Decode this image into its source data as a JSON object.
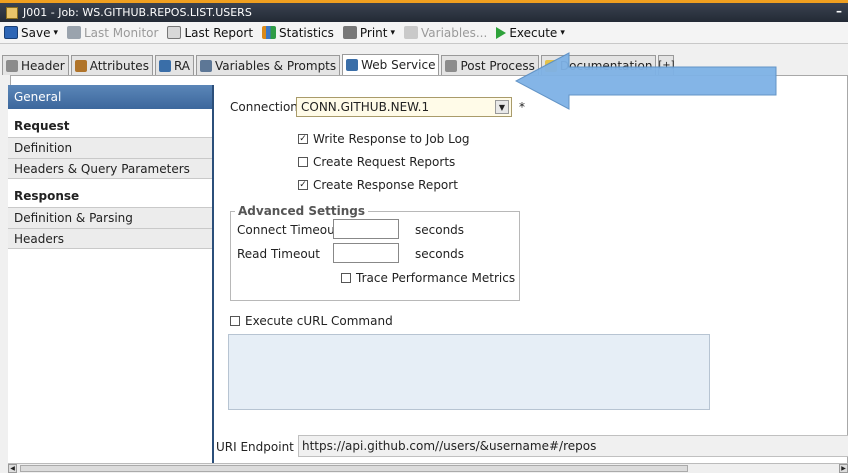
{
  "window": {
    "title": "J001 - Job: WS.GITHUB.REPOS.LIST.USERS",
    "minimize": "–"
  },
  "toolbar": {
    "save": "Save",
    "last_monitor": "Last Monitor",
    "last_report": "Last Report",
    "statistics": "Statistics",
    "print": "Print",
    "variables": "Variables...",
    "execute": "Execute"
  },
  "tabs": [
    {
      "label": "Header"
    },
    {
      "label": "Attributes"
    },
    {
      "label": "RA"
    },
    {
      "label": "Variables & Prompts"
    },
    {
      "label": "Web Service",
      "active": true
    },
    {
      "label": "Post Process"
    },
    {
      "label": "Documentation"
    }
  ],
  "sidebar": {
    "general": "General",
    "request_head": "Request",
    "request_items": [
      "Definition",
      "Headers & Query Parameters"
    ],
    "response_head": "Response",
    "response_items": [
      "Definition & Parsing",
      "Headers"
    ]
  },
  "main": {
    "connection_label": "Connection",
    "connection_value": "CONN.GITHUB.NEW.1",
    "required_mark": "*",
    "write_response": {
      "label": "Write Response to Job Log",
      "checked": true
    },
    "create_request_reports": {
      "label": "Create Request Reports",
      "checked": false
    },
    "create_response_report": {
      "label": "Create Response Report",
      "checked": true
    },
    "advanced_title": "Advanced Settings",
    "connect_timeout_label": "Connect Timeout",
    "connect_timeout_value": "",
    "read_timeout_label": "Read Timeout",
    "read_timeout_value": "",
    "seconds": "seconds",
    "trace_perf": {
      "label": "Trace Performance Metrics",
      "checked": false
    },
    "execute_curl": {
      "label": "Execute cURL Command",
      "checked": false
    },
    "uri_label": "URI Endpoint",
    "uri_value": "https://api.github.com//users/&username#/repos"
  },
  "colors": {
    "accent": "#3c679c",
    "arrow": "#7eb2e6",
    "title_bar": "#2b313d"
  }
}
